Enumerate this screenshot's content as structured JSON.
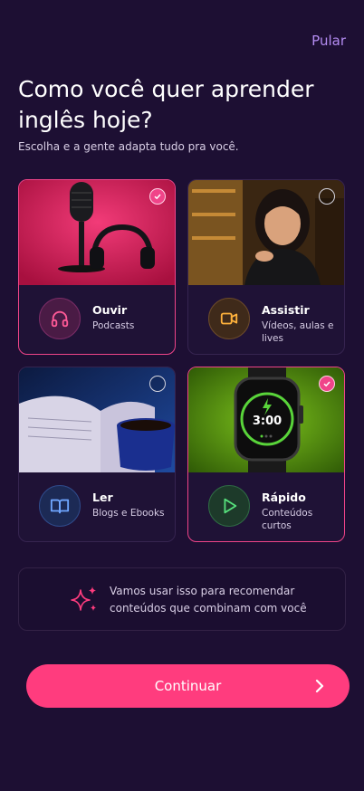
{
  "header": {
    "skip_label": "Pular",
    "title": "Como você quer aprender inglês hoje?",
    "subtitle": "Escolha e a gente adapta tudo pra você."
  },
  "options": [
    {
      "title": "Ouvir",
      "description": "Podcasts",
      "icon": "headphones-icon",
      "selected": true
    },
    {
      "title": "Assistir",
      "description": "Vídeos, aulas e lives",
      "icon": "video-camera-icon",
      "selected": false
    },
    {
      "title": "Ler",
      "description": "Blogs e Ebooks",
      "icon": "book-icon",
      "selected": false
    },
    {
      "title": "Rápido",
      "description": "Conteúdos curtos",
      "icon": "play-icon",
      "selected": true,
      "watch_time": "3:00"
    }
  ],
  "info": {
    "text": "Vamos usar isso para recomendar conteúdos que combinam com você",
    "icon": "sparkles-icon"
  },
  "cta": {
    "label": "Continuar",
    "icon": "chevron-right-icon"
  },
  "colors": {
    "background": "#1d0f33",
    "accent": "#ff3c7e",
    "selected_border": "#f04489",
    "skip": "#b48cf2"
  }
}
